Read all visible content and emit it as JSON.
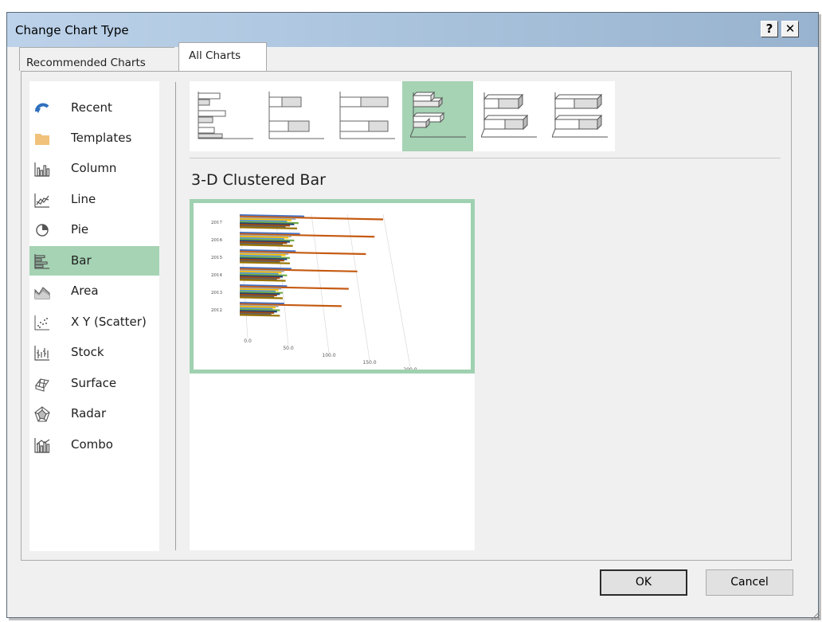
{
  "dialog": {
    "title": "Change Chart Type",
    "help_label": "?",
    "close_label": "✕",
    "tabs": [
      {
        "label": "Recommended Charts",
        "active": false
      },
      {
        "label": "All Charts",
        "active": true
      }
    ],
    "categories": [
      {
        "label": "Recent",
        "icon": "recent-icon",
        "selected": false
      },
      {
        "label": "Templates",
        "icon": "folder-icon",
        "selected": false
      },
      {
        "label": "Column",
        "icon": "column-chart-icon",
        "selected": false
      },
      {
        "label": "Line",
        "icon": "line-chart-icon",
        "selected": false
      },
      {
        "label": "Pie",
        "icon": "pie-chart-icon",
        "selected": false
      },
      {
        "label": "Bar",
        "icon": "bar-chart-icon",
        "selected": true
      },
      {
        "label": "Area",
        "icon": "area-chart-icon",
        "selected": false
      },
      {
        "label": "X Y (Scatter)",
        "icon": "scatter-chart-icon",
        "selected": false
      },
      {
        "label": "Stock",
        "icon": "stock-chart-icon",
        "selected": false
      },
      {
        "label": "Surface",
        "icon": "surface-chart-icon",
        "selected": false
      },
      {
        "label": "Radar",
        "icon": "radar-chart-icon",
        "selected": false
      },
      {
        "label": "Combo",
        "icon": "combo-chart-icon",
        "selected": false
      }
    ],
    "variants": [
      {
        "icon": "clustered-bar-icon",
        "selected": false
      },
      {
        "icon": "stacked-bar-icon",
        "selected": false
      },
      {
        "icon": "100-stacked-bar-icon",
        "selected": false
      },
      {
        "icon": "3d-clustered-bar-icon",
        "selected": true
      },
      {
        "icon": "3d-stacked-bar-icon",
        "selected": false
      },
      {
        "icon": "3d-100-stacked-bar-icon",
        "selected": false
      }
    ],
    "selected_variant_title": "3-D Clustered Bar",
    "ok_label": "OK",
    "cancel_label": "Cancel",
    "accent_color": "#a5d3b4"
  },
  "chart_data": {
    "type": "bar",
    "categories": [
      "2017",
      "2016",
      "2015",
      "2014",
      "2013",
      "2012"
    ],
    "series": [
      {
        "color": "#4472c4",
        "values": [
          90,
          84,
          78,
          72,
          66,
          62
        ]
      },
      {
        "color": "#c55a11",
        "values": [
          200,
          188,
          176,
          164,
          152,
          142
        ]
      },
      {
        "color": "#a5a5a5",
        "values": [
          78,
          72,
          68,
          62,
          58,
          54
        ]
      },
      {
        "color": "#ffc000",
        "values": [
          72,
          68,
          64,
          58,
          54,
          50
        ]
      },
      {
        "color": "#5b9bd5",
        "values": [
          66,
          62,
          58,
          54,
          50,
          46
        ]
      },
      {
        "color": "#70ad47",
        "values": [
          82,
          76,
          70,
          66,
          60,
          56
        ]
      },
      {
        "color": "#264478",
        "values": [
          76,
          70,
          66,
          60,
          56,
          52
        ]
      },
      {
        "color": "#9e480e",
        "values": [
          70,
          66,
          62,
          56,
          52,
          48
        ]
      },
      {
        "color": "#636363",
        "values": [
          64,
          60,
          56,
          52,
          48,
          44
        ]
      },
      {
        "color": "#997300",
        "values": [
          80,
          74,
          70,
          64,
          60,
          56
        ]
      }
    ],
    "xtick_labels": [
      "0.0",
      "50.0",
      "100.0",
      "150.0",
      "200.0"
    ],
    "xlim": [
      0,
      200
    ],
    "grid": true,
    "legend": "none"
  }
}
